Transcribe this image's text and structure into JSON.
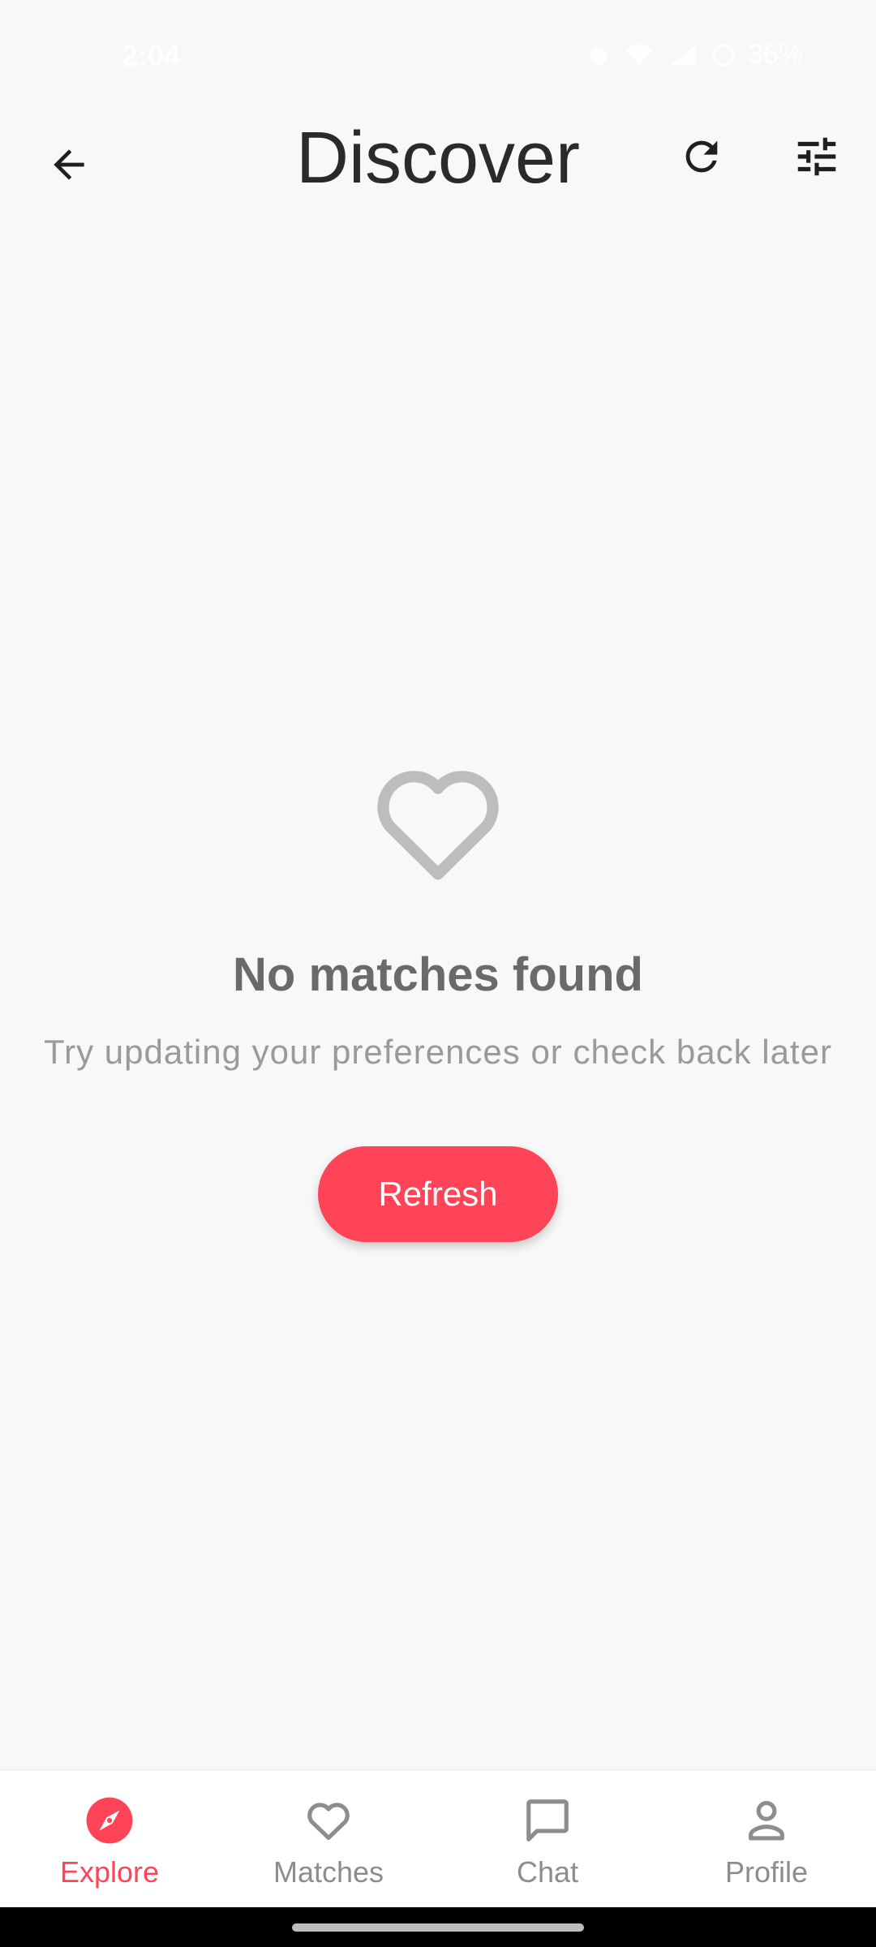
{
  "status_bar": {
    "time": "2:04",
    "battery": "36%"
  },
  "header": {
    "title": "Discover",
    "back_icon": "arrow-back-icon",
    "refresh_icon": "refresh-icon",
    "filter_icon": "tune-sliders-icon"
  },
  "empty_state": {
    "icon": "heart-outline-icon",
    "title": "No matches found",
    "subtitle": "Try updating your preferences or check back later",
    "button_label": "Refresh"
  },
  "bottom_nav": {
    "items": [
      {
        "label": "Explore",
        "icon": "compass-icon",
        "active": true
      },
      {
        "label": "Matches",
        "icon": "heart-icon",
        "active": false
      },
      {
        "label": "Chat",
        "icon": "chat-bubble-icon",
        "active": false
      },
      {
        "label": "Profile",
        "icon": "person-icon",
        "active": false
      }
    ]
  },
  "colors": {
    "accent": "#ff4458",
    "background": "#f8f8f8",
    "inactive": "#8d8d8d"
  }
}
